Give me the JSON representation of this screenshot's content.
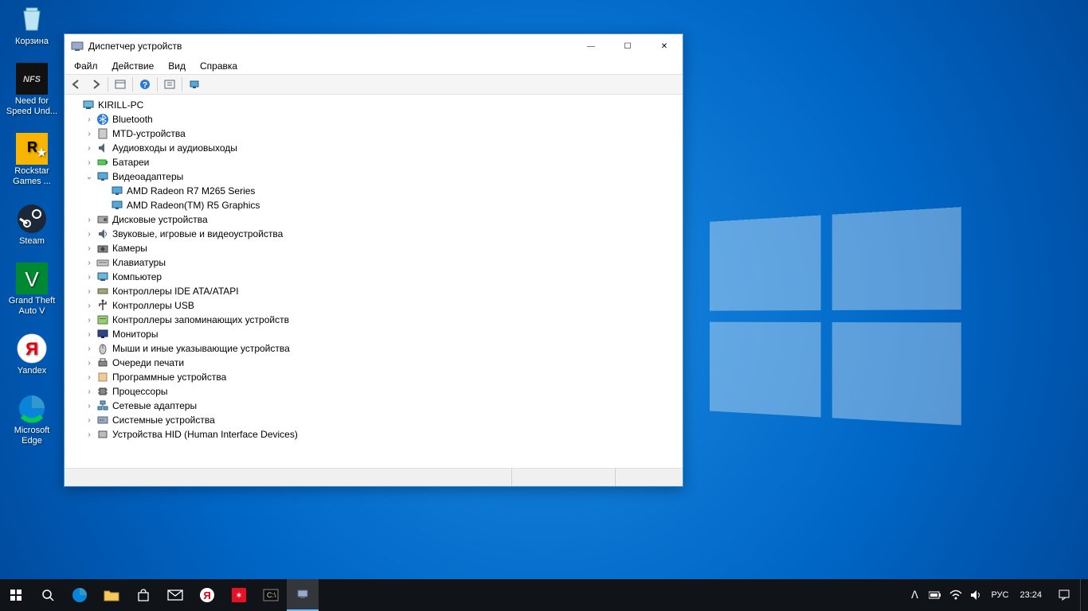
{
  "desktop_icons": [
    {
      "name": "recycle-bin",
      "label": "Корзина",
      "color": "#c9e8f7"
    },
    {
      "name": "nfs",
      "label": "Need for Speed Und...",
      "color": "#222"
    },
    {
      "name": "rockstar",
      "label": "Rockstar Games ...",
      "color": "#f7b500"
    },
    {
      "name": "steam",
      "label": "Steam",
      "color": "#1b2838"
    },
    {
      "name": "gtav",
      "label": "Grand Theft Auto V",
      "color": "#2e7d32"
    },
    {
      "name": "yandex",
      "label": "Yandex",
      "color": "#ffffff"
    },
    {
      "name": "edge",
      "label": "Microsoft Edge",
      "color": "#0a84d8"
    }
  ],
  "window": {
    "title": "Диспетчер устройств",
    "menu": [
      "Файл",
      "Действие",
      "Вид",
      "Справка"
    ],
    "toolbar_icons": [
      "back",
      "forward",
      "sep",
      "show-hidden",
      "sep",
      "help",
      "sep",
      "properties",
      "sep",
      "scan"
    ],
    "root": {
      "label": "KIRILL-PC",
      "expanded": true,
      "icon": "computer",
      "children": [
        {
          "label": "Bluetooth",
          "icon": "bluetooth",
          "expanded": false,
          "hasChildren": true
        },
        {
          "label": "MTD-устройства",
          "icon": "mtd",
          "expanded": false,
          "hasChildren": true
        },
        {
          "label": "Аудиовходы и аудиовыходы",
          "icon": "audio",
          "expanded": false,
          "hasChildren": true
        },
        {
          "label": "Батареи",
          "icon": "battery",
          "expanded": false,
          "hasChildren": true
        },
        {
          "label": "Видеоадаптеры",
          "icon": "display",
          "expanded": true,
          "hasChildren": true,
          "children": [
            {
              "label": "AMD Radeon R7 M265 Series",
              "icon": "display",
              "hasChildren": false
            },
            {
              "label": "AMD Radeon(TM) R5 Graphics",
              "icon": "display",
              "hasChildren": false
            }
          ]
        },
        {
          "label": "Дисковые устройства",
          "icon": "disk",
          "expanded": false,
          "hasChildren": true
        },
        {
          "label": "Звуковые, игровые и видеоустройства",
          "icon": "sound",
          "expanded": false,
          "hasChildren": true
        },
        {
          "label": "Камеры",
          "icon": "camera",
          "expanded": false,
          "hasChildren": true
        },
        {
          "label": "Клавиатуры",
          "icon": "keyboard",
          "expanded": false,
          "hasChildren": true
        },
        {
          "label": "Компьютер",
          "icon": "computer",
          "expanded": false,
          "hasChildren": true
        },
        {
          "label": "Контроллеры IDE ATA/ATAPI",
          "icon": "ide",
          "expanded": false,
          "hasChildren": true
        },
        {
          "label": "Контроллеры USB",
          "icon": "usb",
          "expanded": false,
          "hasChildren": true
        },
        {
          "label": "Контроллеры запоминающих устройств",
          "icon": "storage",
          "expanded": false,
          "hasChildren": true
        },
        {
          "label": "Мониторы",
          "icon": "monitor",
          "expanded": false,
          "hasChildren": true
        },
        {
          "label": "Мыши и иные указывающие устройства",
          "icon": "mouse",
          "expanded": false,
          "hasChildren": true
        },
        {
          "label": "Очереди печати",
          "icon": "printer",
          "expanded": false,
          "hasChildren": true
        },
        {
          "label": "Программные устройства",
          "icon": "software",
          "expanded": false,
          "hasChildren": true
        },
        {
          "label": "Процессоры",
          "icon": "cpu",
          "expanded": false,
          "hasChildren": true
        },
        {
          "label": "Сетевые адаптеры",
          "icon": "network",
          "expanded": false,
          "hasChildren": true
        },
        {
          "label": "Системные устройства",
          "icon": "system",
          "expanded": false,
          "hasChildren": true
        },
        {
          "label": "Устройства HID (Human Interface Devices)",
          "icon": "hid",
          "expanded": false,
          "hasChildren": true
        }
      ]
    }
  },
  "taskbar": {
    "apps": [
      {
        "name": "start",
        "type": "start"
      },
      {
        "name": "search",
        "type": "search"
      },
      {
        "name": "edge",
        "type": "app",
        "color": "#0a84d8"
      },
      {
        "name": "explorer",
        "type": "app",
        "color": "#f7c95c"
      },
      {
        "name": "store",
        "type": "app",
        "color": "#fff"
      },
      {
        "name": "mail",
        "type": "app",
        "color": "#fff"
      },
      {
        "name": "yandex",
        "type": "app",
        "color": "#fff"
      },
      {
        "name": "red-app",
        "type": "app",
        "color": "#e81123"
      },
      {
        "name": "cmd",
        "type": "app",
        "color": "#000"
      },
      {
        "name": "device-manager",
        "type": "app",
        "color": "#888",
        "active": true
      }
    ],
    "tray": {
      "lang": "РУС",
      "clock": "23:24"
    }
  }
}
